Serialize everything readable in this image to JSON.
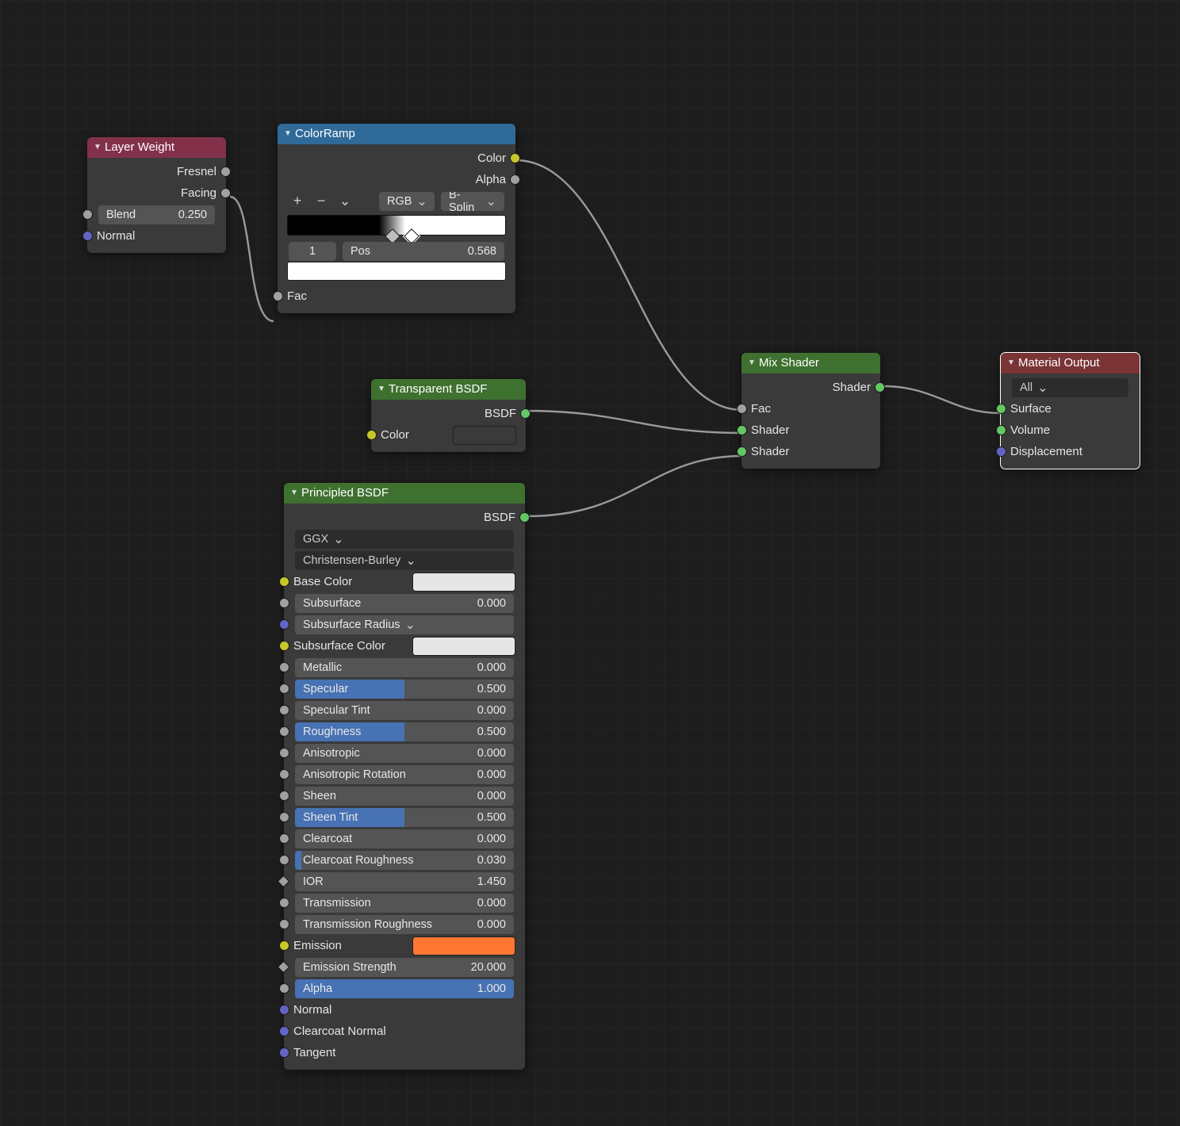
{
  "layerWeight": {
    "title": "Layer Weight",
    "fresnel": "Fresnel",
    "facing": "Facing",
    "blend_label": "Blend",
    "blend_value": "0.250",
    "normal": "Normal"
  },
  "colorRamp": {
    "title": "ColorRamp",
    "color": "Color",
    "alpha": "Alpha",
    "mode": "RGB",
    "interp": "B-Splin",
    "stop_index": "1",
    "pos_label": "Pos",
    "pos_value": "0.568",
    "fac": "Fac"
  },
  "transparent": {
    "title": "Transparent BSDF",
    "bsdf": "BSDF",
    "color": "Color",
    "swatch": "#fff6fb"
  },
  "mixShader": {
    "title": "Mix Shader",
    "shader_out": "Shader",
    "fac": "Fac",
    "shader1": "Shader",
    "shader2": "Shader"
  },
  "materialOutput": {
    "title": "Material Output",
    "target": "All",
    "surface": "Surface",
    "volume": "Volume",
    "displacement": "Displacement"
  },
  "principled": {
    "title": "Principled BSDF",
    "bsdf": "BSDF",
    "distribution": "GGX",
    "sss_method": "Christensen-Burley",
    "base_color_label": "Base Color",
    "base_color": "#e6e6e6",
    "subsurface_label": "Subsurface",
    "subsurface_val": "0.000",
    "subsurface_radius": "Subsurface Radius",
    "subsurface_color_label": "Subsurface Color",
    "subsurface_color": "#e6e6e6",
    "metallic_label": "Metallic",
    "metallic_val": "0.000",
    "specular_label": "Specular",
    "specular_val": "0.500",
    "specular_tint_label": "Specular Tint",
    "specular_tint_val": "0.000",
    "roughness_label": "Roughness",
    "roughness_val": "0.500",
    "anisotropic_label": "Anisotropic",
    "anisotropic_val": "0.000",
    "aniso_rot_label": "Anisotropic Rotation",
    "aniso_rot_val": "0.000",
    "sheen_label": "Sheen",
    "sheen_val": "0.000",
    "sheen_tint_label": "Sheen Tint",
    "sheen_tint_val": "0.500",
    "clearcoat_label": "Clearcoat",
    "clearcoat_val": "0.000",
    "clearcoat_rough_label": "Clearcoat Roughness",
    "clearcoat_rough_val": "0.030",
    "ior_label": "IOR",
    "ior_val": "1.450",
    "transmission_label": "Transmission",
    "transmission_val": "0.000",
    "trans_rough_label": "Transmission Roughness",
    "trans_rough_val": "0.000",
    "emission_label": "Emission",
    "emission_color": "#ff7733",
    "emission_str_label": "Emission Strength",
    "emission_str_val": "20.000",
    "alpha_label": "Alpha",
    "alpha_val": "1.000",
    "normal": "Normal",
    "clearcoat_normal": "Clearcoat Normal",
    "tangent": "Tangent"
  }
}
